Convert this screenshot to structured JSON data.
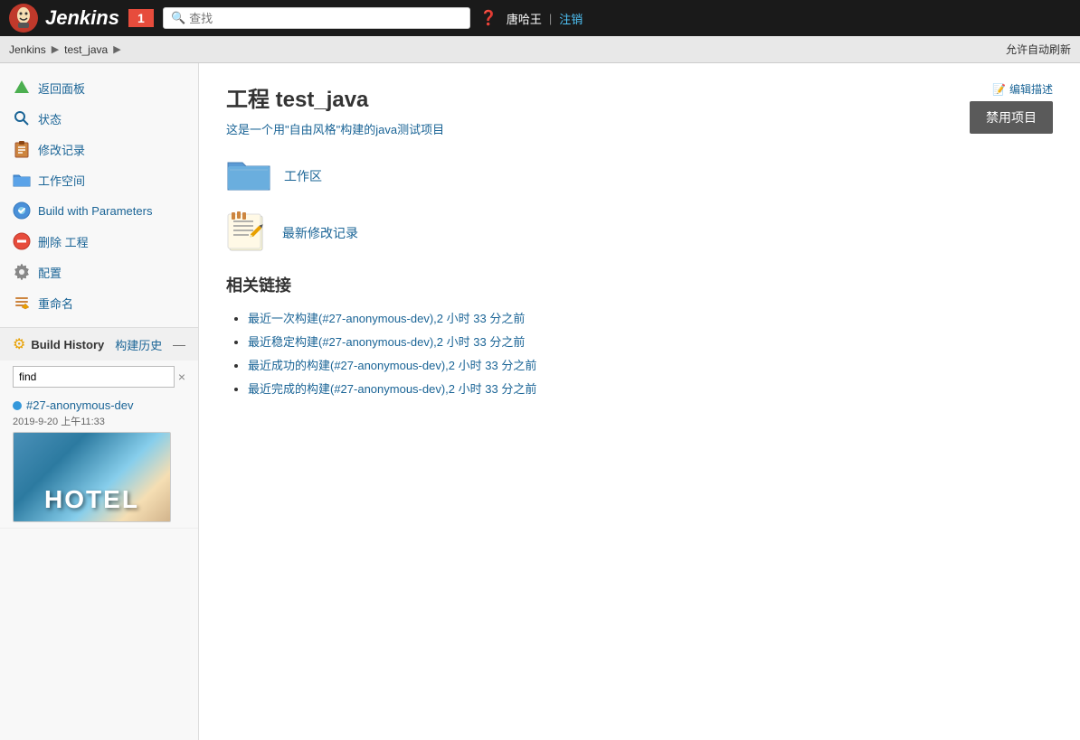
{
  "header": {
    "logo_text": "Jenkins",
    "notification_count": "1",
    "search_placeholder": "查找",
    "user_name": "唐哈王",
    "logout_label": "注销"
  },
  "breadcrumb": {
    "items": [
      "Jenkins",
      "test_java"
    ],
    "auto_refresh": "允许自动刷新"
  },
  "sidebar": {
    "items": [
      {
        "id": "back-panel",
        "label": "返回面板",
        "icon": "up-arrow"
      },
      {
        "id": "status",
        "label": "状态",
        "icon": "magnifier"
      },
      {
        "id": "change-log",
        "label": "修改记录",
        "icon": "clipboard"
      },
      {
        "id": "workspace",
        "label": "工作空间",
        "icon": "folder"
      },
      {
        "id": "build-with-params",
        "label": "Build with Parameters",
        "icon": "build-circle"
      },
      {
        "id": "delete",
        "label": "删除 工程",
        "icon": "no-circle"
      },
      {
        "id": "configure",
        "label": "配置",
        "icon": "gear"
      },
      {
        "id": "rename",
        "label": "重命名",
        "icon": "pencil"
      }
    ],
    "build_history": {
      "title": "Build History",
      "zh_title": "构建历史",
      "find_placeholder": "find",
      "find_clear": "×",
      "build_items": [
        {
          "id": "#27-anonymous-dev",
          "date": "2019-9-20 上午11:33"
        }
      ]
    }
  },
  "content": {
    "project_title": "工程 test_java",
    "project_desc": "这是一个用\"自由风格\"构建的java测试项目",
    "edit_desc_label": "编辑描述",
    "disable_btn": "禁用项目",
    "quick_links": [
      {
        "id": "workspace",
        "label": "工作区"
      },
      {
        "id": "change-log",
        "label": "最新修改记录"
      }
    ],
    "related_links": {
      "title": "相关链接",
      "items": [
        "最近一次构建(#27-anonymous-dev),2 小时 33 分之前",
        "最近稳定构建(#27-anonymous-dev),2 小时 33 分之前",
        "最近成功的构建(#27-anonymous-dev),2 小时 33 分之前",
        "最近完成的构建(#27-anonymous-dev),2 小时 33 分之前"
      ]
    }
  }
}
